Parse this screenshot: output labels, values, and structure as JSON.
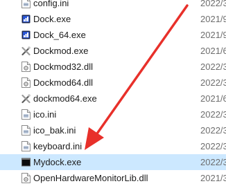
{
  "files": [
    {
      "name": "config.ini",
      "date": "2022/3",
      "icon": "ini-file-icon"
    },
    {
      "name": "Dock.exe",
      "date": "2021/9",
      "icon": "exe-app-icon"
    },
    {
      "name": "Dock_64.exe",
      "date": "2021/9",
      "icon": "exe-app-icon"
    },
    {
      "name": "Dockmod.exe",
      "date": "2021/6",
      "icon": "tools-app-icon"
    },
    {
      "name": "Dockmod32.dll",
      "date": "2022/3",
      "icon": "dll-file-icon"
    },
    {
      "name": "Dockmod64.dll",
      "date": "2022/3",
      "icon": "dll-file-icon"
    },
    {
      "name": "dockmod64.exe",
      "date": "2021/6",
      "icon": "tools-app-icon"
    },
    {
      "name": "ico.ini",
      "date": "2022/3",
      "icon": "ini-file-icon"
    },
    {
      "name": "ico_bak.ini",
      "date": "2022/3",
      "icon": "ini-file-icon"
    },
    {
      "name": "keyboard.ini",
      "date": "2022/3",
      "icon": "ini-file-icon"
    },
    {
      "name": "Mydock.exe",
      "date": "2022/3",
      "icon": "console-app-icon",
      "selected": true
    },
    {
      "name": "OpenHardwareMonitorLib.dll",
      "date": "2021/3",
      "icon": "dll-file-icon"
    }
  ],
  "colors": {
    "selection": "#cce8ff",
    "arrow": "#e8302a",
    "date_text": "#6d6d6d"
  }
}
